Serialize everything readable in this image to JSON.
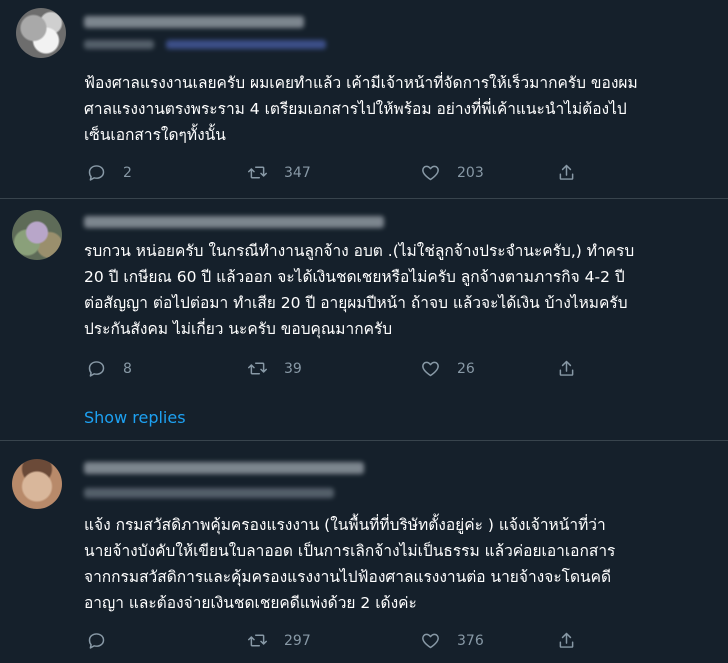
{
  "tweets": [
    {
      "text": "ฟ้องศาลแรงงานเลยครับ ผมเคยทำแล้ว เค้ามีเจ้าหน้าที่จัดการให้เร็วมากครับ ของผม\nศาลแรงงานตรงพระราม 4 เตรียมเอกสารไปให้พร้อม อย่างที่พี่เค้าแนะนำไม่ต้องไป\nเซ็นเอกสารใดๆทั้งนั้น",
      "replies": "2",
      "retweets": "347",
      "likes": "203"
    },
    {
      "text": "รบกวน หน่อยครับ  ในกรณีทำงานลูกจ้าง อบต .(ไม่ใช่ลูกจ้างประจำนะครับ,)  ทำครบ\n20  ปี  เกษียณ 60 ปี แล้วออก จะได้เงินชดเชยหรือไม่ครับ ลูกจ้างตามภารกิจ 4-2 ปี\nต่อสัญญา ต่อไปต่อมา ทำเสีย 20 ปี อายุผมปีหน้า  ถ้าจบ แล้วจะได้เงิน บ้างไหมครับ\nประกันสังคม ไม่เกี่ยว นะครับ ขอบคุณมากครับ",
      "replies": "8",
      "retweets": "39",
      "likes": "26",
      "show_replies": "Show replies"
    },
    {
      "text": "แจ้ง กรมสวัสดิภาพคุ้มครองแรงงาน (ในพื้นที่ที่บริษัทตั้งอยู่ค่ะ ) แจ้งเจ้าหน้าที่ว่า\nนายจ้างบังคับให้เขียนใบลาออด เป็นการเลิกจ้างไม่เป็นธรรม แล้วค่อยเอาเอกสาร\nจากกรมสวัสดิการและคุ้มครองแรงงานไปฟ้องศาลแรงงานต่อ นายจ้างจะโดนคดี\nอาญา และต้องจ่ายเงินชดเชยคดีแพ่งด้วย 2 เด้งค่ะ",
      "retweets": "297",
      "likes": "376"
    }
  ],
  "colors": {
    "background": "#15202b",
    "text": "#ffffff",
    "muted": "#8899a6",
    "link": "#1da1f2",
    "divider": "#38444d"
  }
}
